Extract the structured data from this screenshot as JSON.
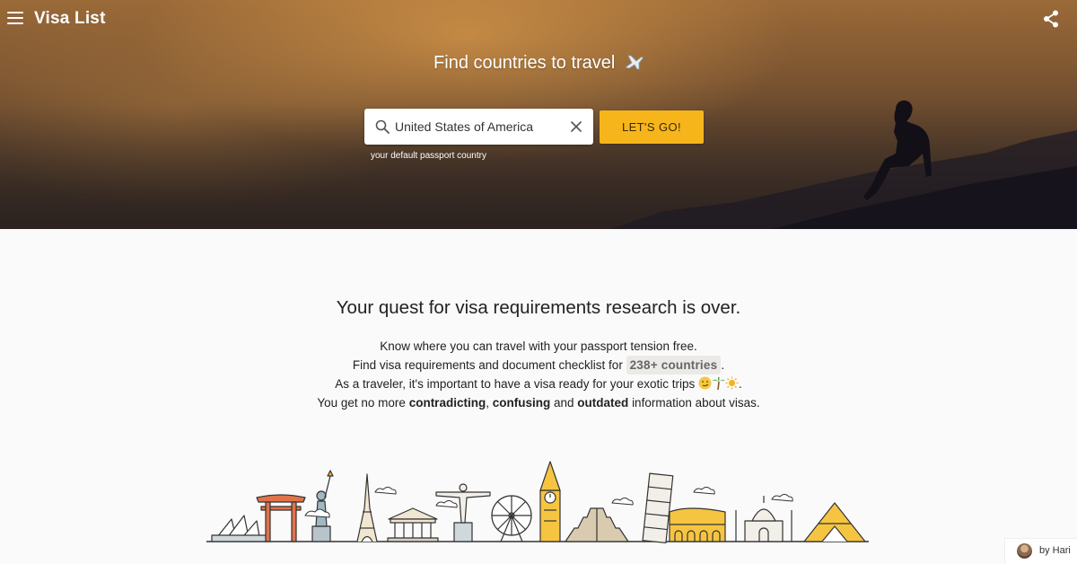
{
  "header": {
    "app_title": "Visa List",
    "menu_icon": "hamburger-menu-icon",
    "share_icon": "share-icon"
  },
  "hero": {
    "heading": "Find countries to travel",
    "heading_icon": "airplane-icon",
    "search": {
      "value": "United States of America",
      "icon": "search-icon",
      "clear_icon": "close-icon"
    },
    "go_button_label": "LET'S GO!",
    "helper_text": "your default passport country"
  },
  "main": {
    "heading": "Your quest for visa requirements research is over.",
    "line1": "Know where you can travel with your passport tension free.",
    "line2_prefix": "Find visa requirements and document checklist for",
    "line2_badge": "238+ countries",
    "line2_suffix": ".",
    "line3_text": "As a traveler, it's important to have a visa ready for your exotic trips",
    "line3_suffix": ".",
    "line4_prefix": "You get no more",
    "line4_bold1": "contradicting",
    "line4_comma": ",",
    "line4_bold2": "confusing",
    "line4_and": "and",
    "line4_bold3": "outdated",
    "line4_suffix": "information about visas."
  },
  "attribution": {
    "text": "by Hari"
  },
  "colors": {
    "accent": "#f7b51c",
    "text_dark": "#222222"
  }
}
